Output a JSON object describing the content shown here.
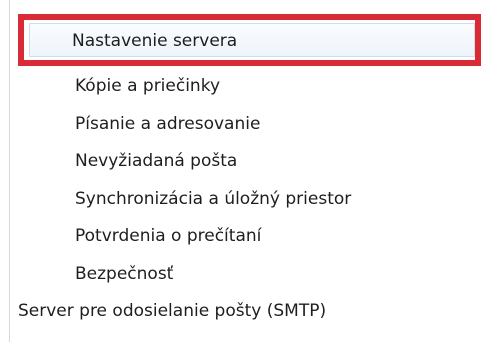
{
  "account_settings_tree": {
    "items": [
      {
        "label": "Nastavenie servera",
        "selected": true
      },
      {
        "label": "Kópie a priečinky"
      },
      {
        "label": "Písanie a adresovanie"
      },
      {
        "label": "Nevyžiadaná pošta"
      },
      {
        "label": "Synchronizácia a úložný priestor"
      },
      {
        "label": "Potvrdenia o prečítaní"
      },
      {
        "label": "Bezpečnosť"
      }
    ],
    "top_level_item": {
      "label": "Server pre odosielanie pošty (SMTP)"
    }
  },
  "colors": {
    "highlight_border": "#d92b35",
    "selection_background": "#eef4fb",
    "text": "#1e1e1e"
  }
}
